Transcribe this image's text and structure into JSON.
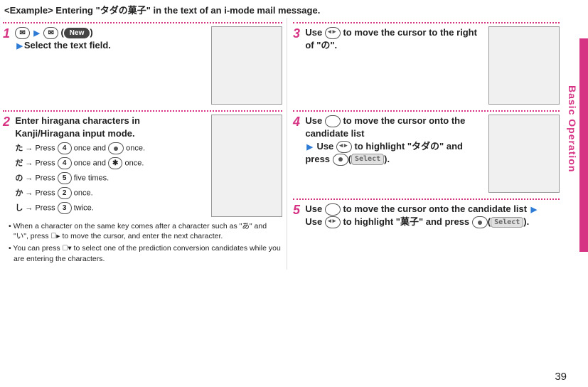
{
  "side_label": "Basic Operation",
  "page_number": "39",
  "example_header": "<Example> Entering \"タダの菓子\" in the text of an i-mode mail message.",
  "step1": {
    "num": "1",
    "icon_mail": "✉",
    "icon_mail2": "✉",
    "key_new": "New",
    "tail": "Select the text field."
  },
  "step2": {
    "num": "2",
    "head": "Enter hiragana characters in Kanji/Hiragana input mode.",
    "lines": {
      "ta": {
        "jp": "た",
        "pre": "→ Press",
        "k1": "4",
        "mid1": " once and ",
        "k2_type": "dpad-center",
        "mid2": " once."
      },
      "da": {
        "jp": "だ",
        "pre": "→ Press",
        "k1": "4",
        "mid1": " once and ",
        "k2": "✱",
        "mid2": " once."
      },
      "no": {
        "jp": "の",
        "pre": "→ Press",
        "k1": "5",
        "tail": " five times."
      },
      "ka": {
        "jp": "か",
        "pre": "→ Press",
        "k1": "2",
        "tail": " once."
      },
      "shi": {
        "jp": "し",
        "pre": "→ Press",
        "k1": "3",
        "tail": " twice."
      }
    },
    "bullets": [
      "When a character on the same key comes after a character such as \"あ\" and \"い\", press  ⃝▸  to move the cursor, and enter the next character.",
      "You can press  ⃝▾  to select one of the prediction conversion candidates while you are entering the characters."
    ]
  },
  "step3": {
    "num": "3",
    "text_a": "Use ",
    "text_b": " to move the cursor to the right of \"の\"."
  },
  "step4": {
    "num": "4",
    "text_a": "Use ",
    "text_b": " to move the cursor onto the candidate list",
    "text_c": "Use ",
    "text_d": " to highlight \"タダの\" and press ",
    "text_e": "(",
    "text_f": ")."
  },
  "step5": {
    "num": "5",
    "text_a": "Use ",
    "text_b": " to move the cursor onto the candidate list",
    "text_c": "Use ",
    "text_d": " to highlight \"菓子\" and press ",
    "text_e": "(",
    "text_f": ")."
  },
  "select_label": "Select"
}
